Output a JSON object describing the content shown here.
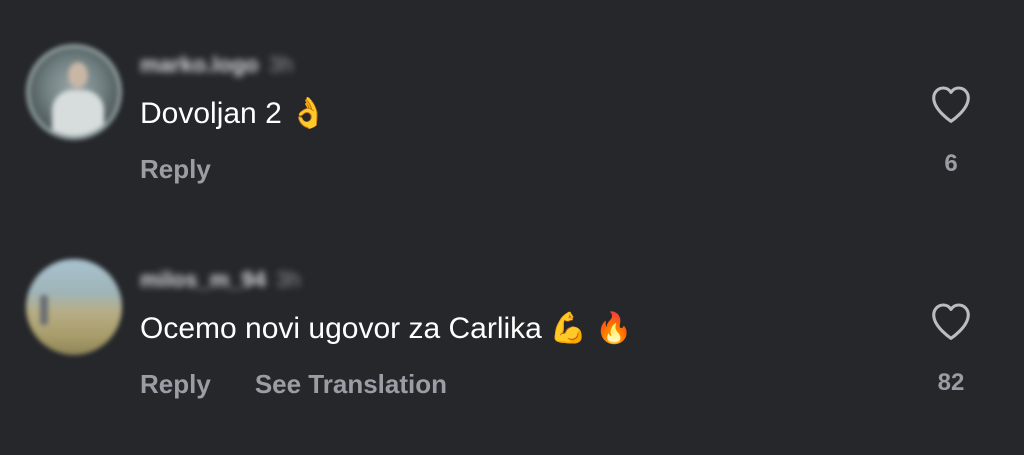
{
  "comments": [
    {
      "username": "marko.logo",
      "time": "3h",
      "text": "Dovoljan 2",
      "emoji": [
        "ok-hand-emoji"
      ],
      "actions": {
        "reply": "Reply"
      },
      "likes": "6"
    },
    {
      "username": "milos_m_94",
      "time": "3h",
      "text": "Ocemo novi ugovor za Carlika",
      "emoji": [
        "flexed-biceps-emoji",
        "fire-emoji"
      ],
      "actions": {
        "reply": "Reply",
        "see_translation": "See Translation"
      },
      "likes": "82"
    }
  ],
  "colors": {
    "background": "#25272b",
    "primary_text": "#ffffff",
    "secondary_text": "#9a9ea4"
  },
  "icons": [
    "heart-outline-icon"
  ]
}
